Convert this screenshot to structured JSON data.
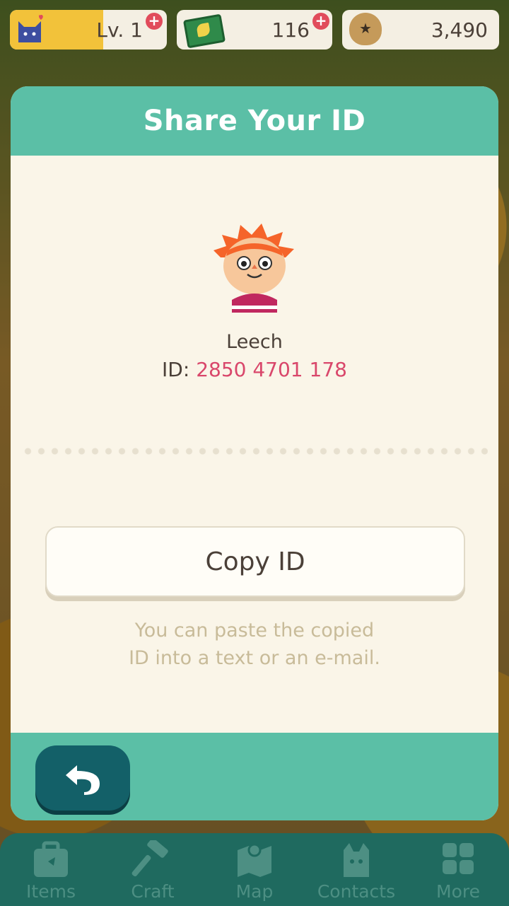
{
  "hud": {
    "level_label": "Lv. 1",
    "leaf_tickets": "116",
    "bells": "3,490"
  },
  "modal": {
    "title": "Share Your ID",
    "player_name": "Leech",
    "id_prefix": "ID: ",
    "id_number": "2850 4701 178",
    "copy_button": "Copy ID",
    "hint_line1": "You can paste the copied",
    "hint_line2": "ID into a text or an e-mail."
  },
  "nav": {
    "items": [
      {
        "label": "Items",
        "icon": "bag-icon"
      },
      {
        "label": "Craft",
        "icon": "hammer-icon"
      },
      {
        "label": "Map",
        "icon": "map-icon"
      },
      {
        "label": "Contacts",
        "icon": "cat-icon"
      },
      {
        "label": "More",
        "icon": "grid-icon"
      }
    ]
  },
  "colors": {
    "accent_teal": "#5bbfa6",
    "back_button": "#136068",
    "id_highlight": "#d9476b",
    "nav_bg": "#1f6a5f"
  }
}
